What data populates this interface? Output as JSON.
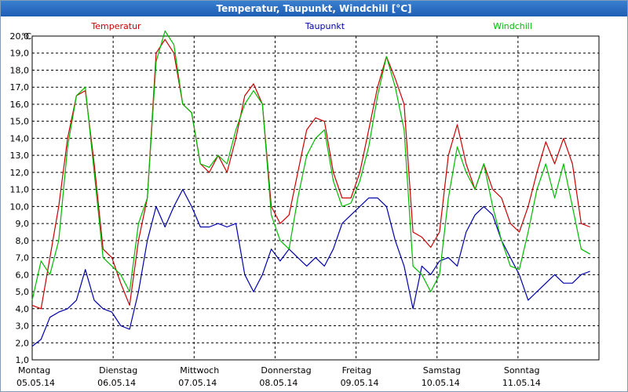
{
  "window": {
    "title": "Temperatur, Taupunkt, Windchill [°C]"
  },
  "chart_data": {
    "type": "line",
    "title": "Temperatur, Taupunkt, Windchill [°C]",
    "y_unit": "°C",
    "ylim": [
      1.0,
      20.0
    ],
    "y_ticks": [
      "1,0",
      "2,0",
      "3,0",
      "4,0",
      "5,0",
      "6,0",
      "7,0",
      "8,0",
      "9,0",
      "10,0",
      "11,0",
      "12,0",
      "13,0",
      "14,0",
      "15,0",
      "16,0",
      "17,0",
      "18,0",
      "19,0",
      "20,0"
    ],
    "x_days": [
      {
        "weekday": "Montag",
        "date": "05.05.14"
      },
      {
        "weekday": "Dienstag",
        "date": "06.05.14"
      },
      {
        "weekday": "Mittwoch",
        "date": "07.05.14"
      },
      {
        "weekday": "Donnerstag",
        "date": "08.05.14"
      },
      {
        "weekday": "Freitag",
        "date": "09.05.14"
      },
      {
        "weekday": "Samstag",
        "date": "10.05.14"
      },
      {
        "weekday": "Sonntag",
        "date": "11.05.14"
      }
    ],
    "x_start": "05.05.14 00:00",
    "hours_per_point": 3,
    "grid": true,
    "legend_position": "top",
    "series": [
      {
        "name": "Temperatur",
        "color": "#cc0000",
        "values": [
          4.2,
          4.0,
          7.0,
          10.0,
          14.0,
          16.5,
          16.8,
          12.5,
          7.5,
          7.0,
          5.5,
          4.2,
          8.0,
          10.5,
          19.0,
          19.8,
          19.0,
          16.0,
          15.5,
          12.5,
          12.0,
          13.0,
          12.0,
          14.0,
          16.5,
          17.2,
          16.0,
          10.0,
          9.0,
          9.5,
          12.0,
          14.5,
          15.2,
          15.0,
          12.0,
          10.5,
          10.5,
          12.0,
          14.5,
          17.0,
          18.8,
          17.5,
          16.0,
          8.5,
          8.2,
          7.6,
          8.5,
          13.0,
          14.8,
          12.5,
          11.0,
          12.5,
          11.0,
          10.5,
          9.0,
          8.5,
          10.0,
          12.0,
          13.8,
          12.5,
          14.0,
          12.5,
          9.0,
          8.8
        ]
      },
      {
        "name": "Taupunkt",
        "color": "#0000aa",
        "values": [
          1.8,
          2.2,
          3.5,
          3.8,
          4.0,
          4.5,
          6.3,
          4.5,
          4.0,
          3.8,
          3.0,
          2.8,
          5.0,
          8.0,
          10.0,
          8.8,
          10.0,
          11.0,
          10.0,
          8.8,
          8.8,
          9.0,
          8.8,
          9.0,
          6.0,
          5.0,
          6.0,
          7.5,
          6.8,
          7.5,
          7.0,
          6.5,
          7.0,
          6.5,
          7.5,
          9.0,
          9.5,
          10.0,
          10.5,
          10.5,
          10.0,
          8.0,
          6.5,
          4.0,
          6.5,
          6.0,
          6.8,
          7.0,
          6.5,
          8.5,
          9.5,
          10.0,
          9.5,
          8.0,
          7.0,
          6.0,
          4.5,
          5.0,
          5.5,
          6.0,
          5.5,
          5.5,
          6.0,
          6.2
        ]
      },
      {
        "name": "Windchill",
        "color": "#00bb00",
        "values": [
          4.5,
          6.8,
          6.0,
          8.0,
          13.5,
          16.5,
          17.0,
          12.0,
          7.0,
          6.5,
          6.0,
          5.0,
          9.0,
          10.5,
          18.5,
          20.3,
          19.5,
          16.0,
          15.5,
          12.5,
          12.3,
          13.0,
          12.5,
          14.5,
          16.0,
          16.8,
          16.0,
          9.5,
          8.0,
          7.5,
          10.5,
          13.0,
          14.0,
          14.5,
          11.5,
          10.0,
          10.2,
          11.5,
          13.5,
          16.5,
          18.8,
          17.0,
          14.5,
          6.5,
          6.0,
          5.0,
          6.0,
          10.5,
          13.5,
          12.0,
          11.0,
          12.5,
          10.0,
          8.0,
          6.5,
          6.3,
          8.5,
          11.0,
          12.5,
          10.5,
          12.5,
          10.0,
          7.5,
          7.2
        ]
      }
    ]
  }
}
